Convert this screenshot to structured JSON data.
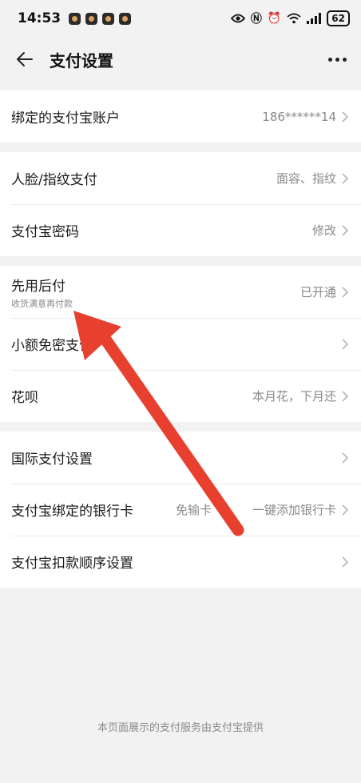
{
  "status_bar": {
    "time": "14:53",
    "battery": "62",
    "icons": [
      "eye-icon",
      "nfc-icon",
      "alarm-icon",
      "wifi-icon",
      "signal-icon"
    ]
  },
  "nav": {
    "title": "支付设置",
    "back_icon": "arrow-left-icon",
    "more_icon": "more-dots-icon"
  },
  "groups": {
    "account": {
      "label": "绑定的支付宝账户",
      "value": "186******14"
    },
    "auth": {
      "face_label": "人脸/指纹支付",
      "face_value": "面容、指纹",
      "password_label": "支付宝密码",
      "password_value": "修改"
    },
    "credit": {
      "paylater_label": "先用后付",
      "paylater_sub": "收货满意再付款",
      "paylater_value": "已开通",
      "small_label": "小额免密支付",
      "huabei_label": "花呗",
      "huabei_value": "本月花，下月还"
    },
    "other": {
      "intl_label": "国际支付设置",
      "bank_label": "支付宝绑定的银行卡",
      "bank_tag": "免输卡",
      "bank_value": "一键添加银行卡",
      "order_label": "支付宝扣款顺序设置"
    }
  },
  "footer": "本页面展示的支付服务由支付宝提供",
  "colors": {
    "background": "#f2f2f2",
    "card": "#ffffff",
    "secondary_text": "#8a8a8a",
    "annotation_arrow": "#e8402f"
  }
}
